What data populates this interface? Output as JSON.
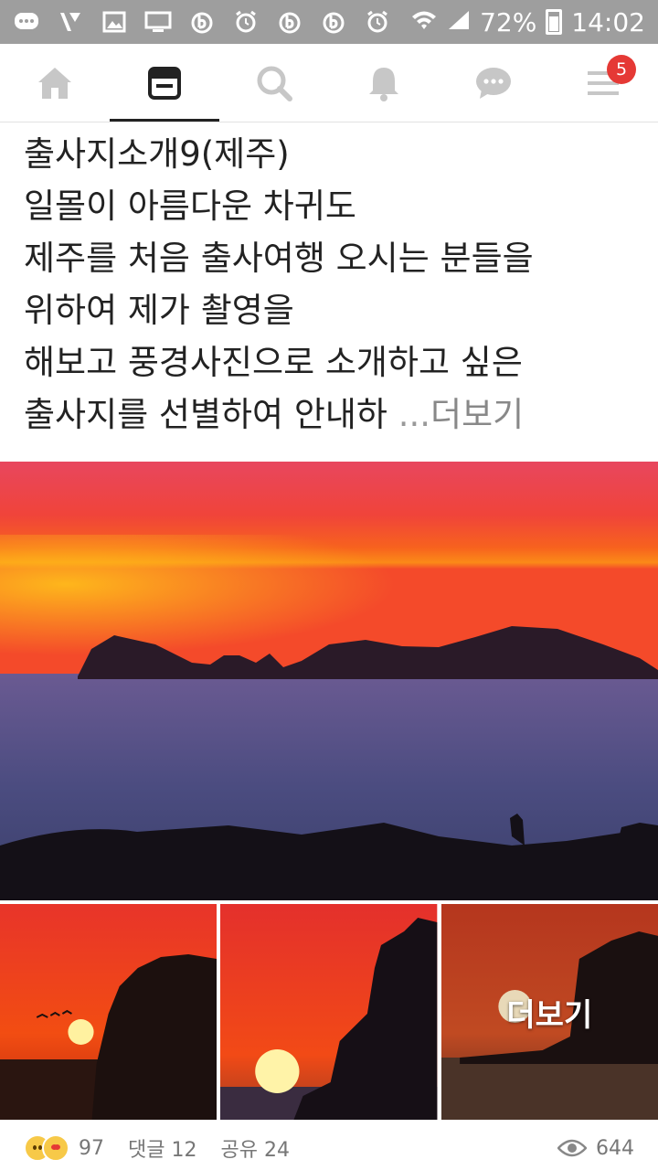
{
  "status_bar": {
    "battery": "72%",
    "time": "14:02",
    "icons": [
      "chat-bubble-icon",
      "v-icon",
      "image-icon",
      "monitor-icon",
      "b-app-icon",
      "alarm-icon",
      "b-app-icon",
      "b-app-icon",
      "alarm-icon",
      "wifi-icon",
      "signal-icon",
      "battery-icon"
    ]
  },
  "nav": {
    "items": [
      "home-icon",
      "feed-icon",
      "search-icon",
      "bell-icon",
      "chat-icon",
      "menu-icon"
    ],
    "active": "feed-icon",
    "menu_badge": "5"
  },
  "post": {
    "lines": [
      "출사지소개9(제주)",
      "일몰이 아름다운 차귀도",
      "제주를 처음 출사여행 오시는 분들을",
      "위하여 제가 촬영을",
      "해보고 풍경사진으로 소개하고 싶은"
    ],
    "last_line": "출사지를 선별하여 안내하",
    "ellipsis": "...",
    "more_label": "더보기",
    "photo_more_label": "더보기"
  },
  "footer": {
    "reaction_count": "97",
    "comments": "댓글 12",
    "shares": "공유 24",
    "views": "644"
  }
}
